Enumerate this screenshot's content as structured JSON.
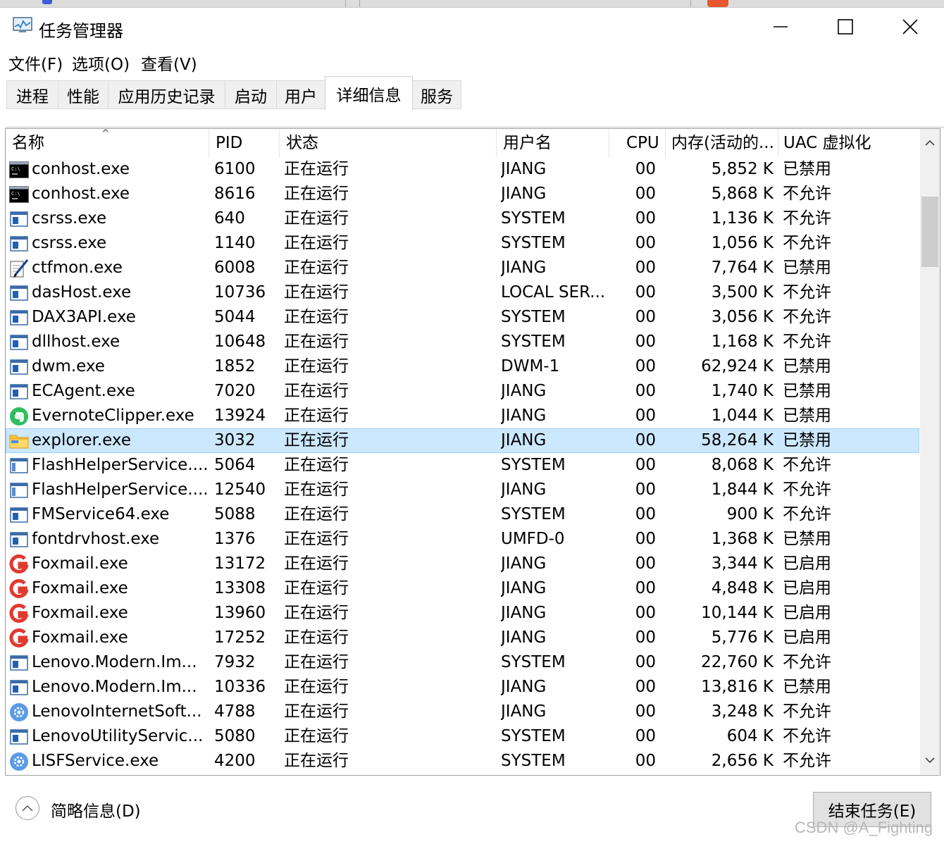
{
  "window": {
    "title": "任务管理器"
  },
  "menu": [
    "文件(F)",
    "选项(O)",
    "查看(V)"
  ],
  "tabs": [
    "进程",
    "性能",
    "应用历史记录",
    "启动",
    "用户",
    "详细信息",
    "服务"
  ],
  "active_tab": "详细信息",
  "columns": [
    "名称",
    "PID",
    "状态",
    "用户名",
    "CPU",
    "内存(活动的...",
    "UAC 虚拟化"
  ],
  "rows": [
    {
      "name": "conhost.exe",
      "pid": "6100",
      "status": "正在运行",
      "user": "JIANG",
      "cpu": "00",
      "mem": "5,852 K",
      "uac": "已禁用",
      "icon": "console-icon"
    },
    {
      "name": "conhost.exe",
      "pid": "8616",
      "status": "正在运行",
      "user": "JIANG",
      "cpu": "00",
      "mem": "5,868 K",
      "uac": "不允许",
      "icon": "console-icon"
    },
    {
      "name": "csrss.exe",
      "pid": "640",
      "status": "正在运行",
      "user": "SYSTEM",
      "cpu": "00",
      "mem": "1,136 K",
      "uac": "不允许",
      "icon": "window-icon"
    },
    {
      "name": "csrss.exe",
      "pid": "1140",
      "status": "正在运行",
      "user": "SYSTEM",
      "cpu": "00",
      "mem": "1,056 K",
      "uac": "不允许",
      "icon": "window-icon"
    },
    {
      "name": "ctfmon.exe",
      "pid": "6008",
      "status": "正在运行",
      "user": "JIANG",
      "cpu": "00",
      "mem": "7,764 K",
      "uac": "已禁用",
      "icon": "pen-icon"
    },
    {
      "name": "dasHost.exe",
      "pid": "10736",
      "status": "正在运行",
      "user": "LOCAL SER...",
      "cpu": "00",
      "mem": "3,500 K",
      "uac": "不允许",
      "icon": "window-icon"
    },
    {
      "name": "DAX3API.exe",
      "pid": "5044",
      "status": "正在运行",
      "user": "SYSTEM",
      "cpu": "00",
      "mem": "3,056 K",
      "uac": "不允许",
      "icon": "window-icon"
    },
    {
      "name": "dllhost.exe",
      "pid": "10648",
      "status": "正在运行",
      "user": "SYSTEM",
      "cpu": "00",
      "mem": "1,168 K",
      "uac": "不允许",
      "icon": "window-icon"
    },
    {
      "name": "dwm.exe",
      "pid": "1852",
      "status": "正在运行",
      "user": "DWM-1",
      "cpu": "00",
      "mem": "62,924 K",
      "uac": "已禁用",
      "icon": "window-icon"
    },
    {
      "name": "ECAgent.exe",
      "pid": "7020",
      "status": "正在运行",
      "user": "JIANG",
      "cpu": "00",
      "mem": "1,740 K",
      "uac": "已禁用",
      "icon": "window-icon"
    },
    {
      "name": "EvernoteClipper.exe",
      "pid": "13924",
      "status": "正在运行",
      "user": "JIANG",
      "cpu": "00",
      "mem": "1,044 K",
      "uac": "已禁用",
      "icon": "evernote-icon"
    },
    {
      "name": "explorer.exe",
      "pid": "3032",
      "status": "正在运行",
      "user": "JIANG",
      "cpu": "00",
      "mem": "58,264 K",
      "uac": "已禁用",
      "icon": "folder-icon",
      "selected": true
    },
    {
      "name": "FlashHelperService....",
      "pid": "5064",
      "status": "正在运行",
      "user": "SYSTEM",
      "cpu": "00",
      "mem": "8,068 K",
      "uac": "不允许",
      "icon": "blank-window-icon"
    },
    {
      "name": "FlashHelperService....",
      "pid": "12540",
      "status": "正在运行",
      "user": "JIANG",
      "cpu": "00",
      "mem": "1,844 K",
      "uac": "不允许",
      "icon": "blank-window-icon"
    },
    {
      "name": "FMService64.exe",
      "pid": "5088",
      "status": "正在运行",
      "user": "SYSTEM",
      "cpu": "00",
      "mem": "900 K",
      "uac": "不允许",
      "icon": "window-icon"
    },
    {
      "name": "fontdrvhost.exe",
      "pid": "1376",
      "status": "正在运行",
      "user": "UMFD-0",
      "cpu": "00",
      "mem": "1,368 K",
      "uac": "已禁用",
      "icon": "window-icon"
    },
    {
      "name": "Foxmail.exe",
      "pid": "13172",
      "status": "正在运行",
      "user": "JIANG",
      "cpu": "00",
      "mem": "3,344 K",
      "uac": "已启用",
      "icon": "foxmail-icon"
    },
    {
      "name": "Foxmail.exe",
      "pid": "13308",
      "status": "正在运行",
      "user": "JIANG",
      "cpu": "00",
      "mem": "4,848 K",
      "uac": "已启用",
      "icon": "foxmail-icon"
    },
    {
      "name": "Foxmail.exe",
      "pid": "13960",
      "status": "正在运行",
      "user": "JIANG",
      "cpu": "00",
      "mem": "10,144 K",
      "uac": "已启用",
      "icon": "foxmail-icon"
    },
    {
      "name": "Foxmail.exe",
      "pid": "17252",
      "status": "正在运行",
      "user": "JIANG",
      "cpu": "00",
      "mem": "5,776 K",
      "uac": "已启用",
      "icon": "foxmail-icon"
    },
    {
      "name": "Lenovo.Modern.Im...",
      "pid": "7932",
      "status": "正在运行",
      "user": "SYSTEM",
      "cpu": "00",
      "mem": "22,760 K",
      "uac": "不允许",
      "icon": "window-icon"
    },
    {
      "name": "Lenovo.Modern.Im...",
      "pid": "10336",
      "status": "正在运行",
      "user": "JIANG",
      "cpu": "00",
      "mem": "13,816 K",
      "uac": "已禁用",
      "icon": "window-icon"
    },
    {
      "name": "LenovoInternetSoft...",
      "pid": "4788",
      "status": "正在运行",
      "user": "JIANG",
      "cpu": "00",
      "mem": "3,248 K",
      "uac": "不允许",
      "icon": "gear-circle-icon"
    },
    {
      "name": "LenovoUtilityServic...",
      "pid": "5080",
      "status": "正在运行",
      "user": "SYSTEM",
      "cpu": "00",
      "mem": "604 K",
      "uac": "不允许",
      "icon": "window-icon"
    },
    {
      "name": "LISFService.exe",
      "pid": "4200",
      "status": "正在运行",
      "user": "SYSTEM",
      "cpu": "00",
      "mem": "2,656 K",
      "uac": "不允许",
      "icon": "gear-circle-icon"
    }
  ],
  "footer": {
    "fewer_details": "简略信息(D)",
    "end_task": "结束任务(E)"
  },
  "watermark": "CSDN @A_Fighting"
}
